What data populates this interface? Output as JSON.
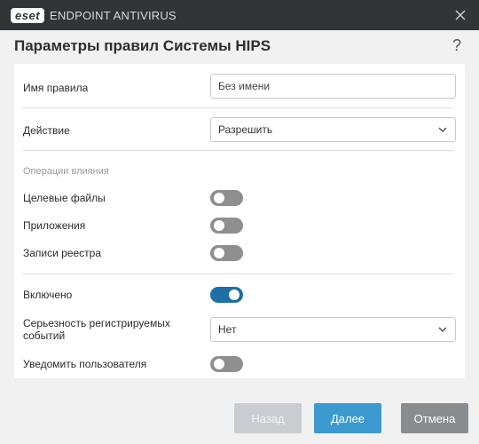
{
  "titlebar": {
    "logo_text": "eset",
    "app_name": "ENDPOINT ANTIVIRUS"
  },
  "header": {
    "title": "Параметры правил Системы HIPS",
    "help_label": "?"
  },
  "form": {
    "rule_name_label": "Имя правила",
    "rule_name_placeholder": "Без имени",
    "action_label": "Действие",
    "action_value": "Разрешить",
    "operations_section": "Операции влияния",
    "target_files_label": "Целевые файлы",
    "target_files_on": false,
    "applications_label": "Приложения",
    "applications_on": false,
    "registry_label": "Записи реестра",
    "registry_on": false,
    "enabled_label": "Включено",
    "enabled_on": true,
    "severity_label_line1": "Серьезность регистрируемых",
    "severity_label_line2": "событий",
    "severity_value": "Нет",
    "notify_label": "Уведомить пользователя",
    "notify_on": false
  },
  "footer": {
    "back_label": "Назад",
    "next_label": "Далее",
    "cancel_label": "Отмена"
  },
  "colors": {
    "titlebar": "#333437",
    "toggle_on": "#1d6fa5",
    "toggle_off": "#8f8f8f",
    "primary_button": "#3d9ad1",
    "cancel_button": "#8a8d90",
    "disabled_button": "#c9cdd2"
  }
}
